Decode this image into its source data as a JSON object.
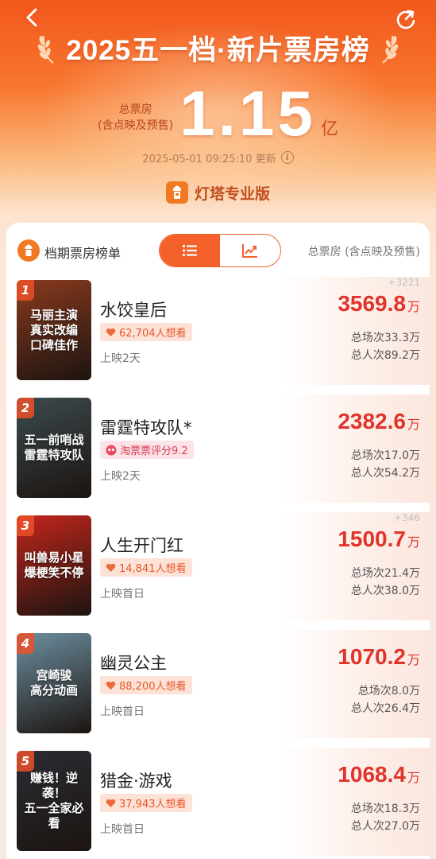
{
  "header": {
    "title": "2025五一档·新片票房榜",
    "total_label_line1": "总票房",
    "total_label_line2": "(含点映及预售)",
    "total_value": "1.15",
    "total_unit": "亿",
    "updated": "2025-05-01 09:25:10 更新",
    "brand": "灯塔专业版"
  },
  "list": {
    "title": "档期票房榜单",
    "column_label": "总票房 (含点映及预售)",
    "toggle": {
      "active": "list-icon",
      "inactive": "trend-chart-icon"
    }
  },
  "movies": [
    {
      "rank": "1",
      "title": "水饺皇后",
      "tag_type": "want",
      "tag": "62,704人想看",
      "release": "上映2天",
      "delta": "+3221",
      "boxoffice": "3569.8",
      "unit": "万",
      "sessions": "总场次33.3万",
      "admissions": "总人次89.2万",
      "poster_text": "马丽主演\n真实改编\n口碑佳作",
      "poster_color": "#8a3a1e"
    },
    {
      "rank": "2",
      "title": "雷霆特攻队*",
      "tag_type": "rating",
      "tag": "淘票票评分9.2",
      "release": "上映2天",
      "delta": "",
      "boxoffice": "2382.6",
      "unit": "万",
      "sessions": "总场次17.0万",
      "admissions": "总人次54.2万",
      "poster_text": "五一前哨战\n雷霆特攻队",
      "poster_color": "#3c4a4e"
    },
    {
      "rank": "3",
      "title": "人生开门红",
      "tag_type": "want",
      "tag": "14,841人想看",
      "release": "上映首日",
      "delta": "+346",
      "boxoffice": "1500.7",
      "unit": "万",
      "sessions": "总场次21.4万",
      "admissions": "总人次38.0万",
      "poster_text": "叫兽易小星\n爆梗笑不停",
      "poster_color": "#c2261c"
    },
    {
      "rank": "4",
      "title": "幽灵公主",
      "tag_type": "want",
      "tag": "88,200人想看",
      "release": "上映首日",
      "delta": "",
      "boxoffice": "1070.2",
      "unit": "万",
      "sessions": "总场次8.0万",
      "admissions": "总人次26.4万",
      "poster_text": "宫崎骏\n高分动画",
      "poster_color": "#6d8fa0"
    },
    {
      "rank": "5",
      "title": "猎金·游戏",
      "tag_type": "want",
      "tag": "37,943人想看",
      "release": "上映首日",
      "delta": "",
      "boxoffice": "1068.4",
      "unit": "万",
      "sessions": "总场次18.3万",
      "admissions": "总人次27.0万",
      "poster_text": "赚钱！逆袭！\n五一全家必看",
      "poster_color": "#2b2c33"
    }
  ],
  "colors": {
    "accent": "#f4602a",
    "boxoffice": "#e0332a",
    "header_top": "#f2571c"
  }
}
